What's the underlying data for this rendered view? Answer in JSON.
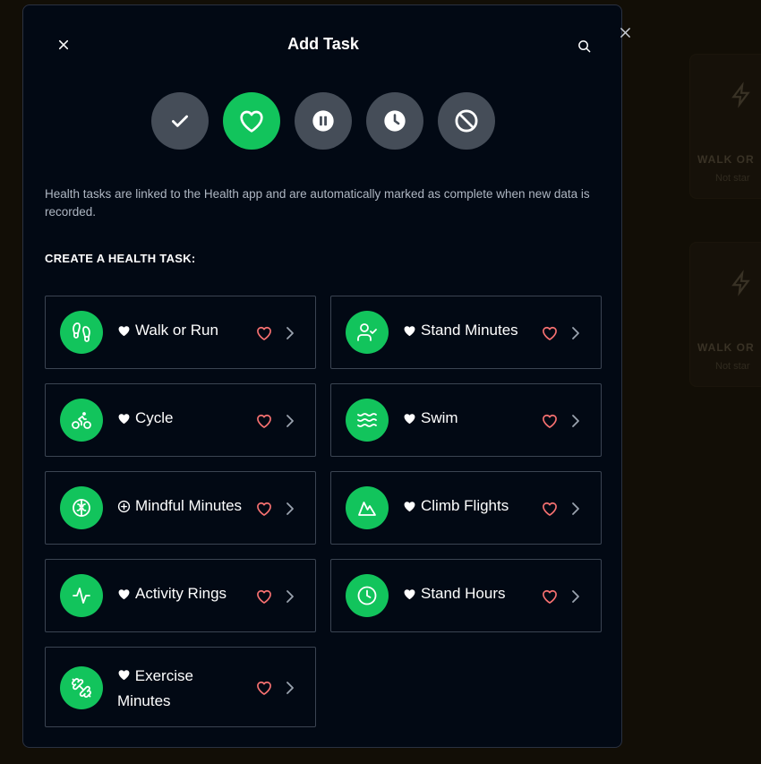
{
  "background": {
    "label": "WALK OR",
    "sub": "Not star"
  },
  "modal": {
    "title": "Add Task",
    "description": "Health tasks are linked to the Health app and are automatically marked as complete when new data is recorded.",
    "section_title": "CREATE A HEALTH TASK:",
    "task_types": [
      {
        "name": "check-icon",
        "active": false
      },
      {
        "name": "heart-icon",
        "active": true
      },
      {
        "name": "pause-icon",
        "active": false
      },
      {
        "name": "clock-icon",
        "active": false
      },
      {
        "name": "ban-icon",
        "active": false
      }
    ],
    "tasks": [
      {
        "label": "Walk or Run",
        "icon": "footprints-icon",
        "marker": "heart"
      },
      {
        "label": "Stand Minutes",
        "icon": "person-check-icon",
        "marker": "heart"
      },
      {
        "label": "Cycle",
        "icon": "bike-icon",
        "marker": "heart"
      },
      {
        "label": "Swim",
        "icon": "waves-icon",
        "marker": "heart"
      },
      {
        "label": "Mindful Minutes",
        "icon": "brain-icon",
        "marker": "plus-circle"
      },
      {
        "label": "Climb Flights",
        "icon": "mountain-icon",
        "marker": "heart"
      },
      {
        "label": "Activity Rings",
        "icon": "activity-icon",
        "marker": "heart"
      },
      {
        "label": "Stand Hours",
        "icon": "clock-icon",
        "marker": "heart"
      },
      {
        "label": "Exercise Minutes",
        "icon": "dumbbell-icon",
        "marker": "heart"
      }
    ]
  },
  "colors": {
    "accent": "#12c45c",
    "favorite_heart": "#f87171",
    "modal_bg": "#020914",
    "inactive_circle": "#454d58"
  }
}
